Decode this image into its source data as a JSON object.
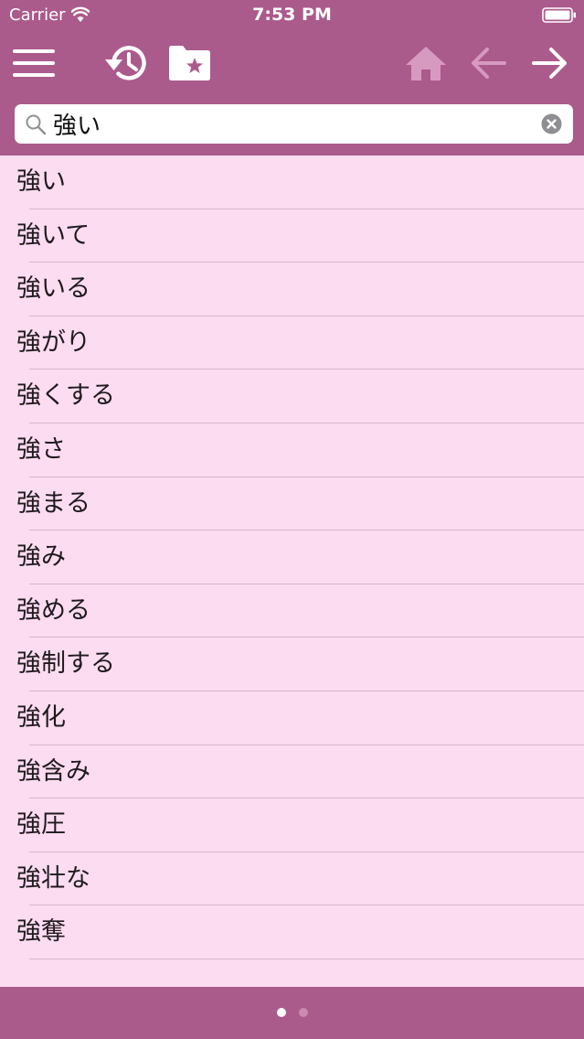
{
  "status_bar": {
    "carrier": "Carrier",
    "time": "7:53 PM"
  },
  "toolbar": {
    "icons": [
      "menu-icon",
      "history-icon",
      "favorites-folder-icon",
      "home-icon",
      "back-arrow-icon",
      "forward-arrow-icon"
    ]
  },
  "search": {
    "value": "強い"
  },
  "results": [
    "強い",
    "強いて",
    "強いる",
    "強がり",
    "強くする",
    "強さ",
    "強まる",
    "強み",
    "強める",
    "強制する",
    "強化",
    "強含み",
    "強圧",
    "強壮な",
    "強奪"
  ],
  "pagination": {
    "total": 2,
    "current": 1
  },
  "colors": {
    "bar": "#ab5a8c",
    "list_background": "#fcdcf1",
    "separator": "#d8b6cb",
    "disabled_icon": "#d69ac0"
  }
}
